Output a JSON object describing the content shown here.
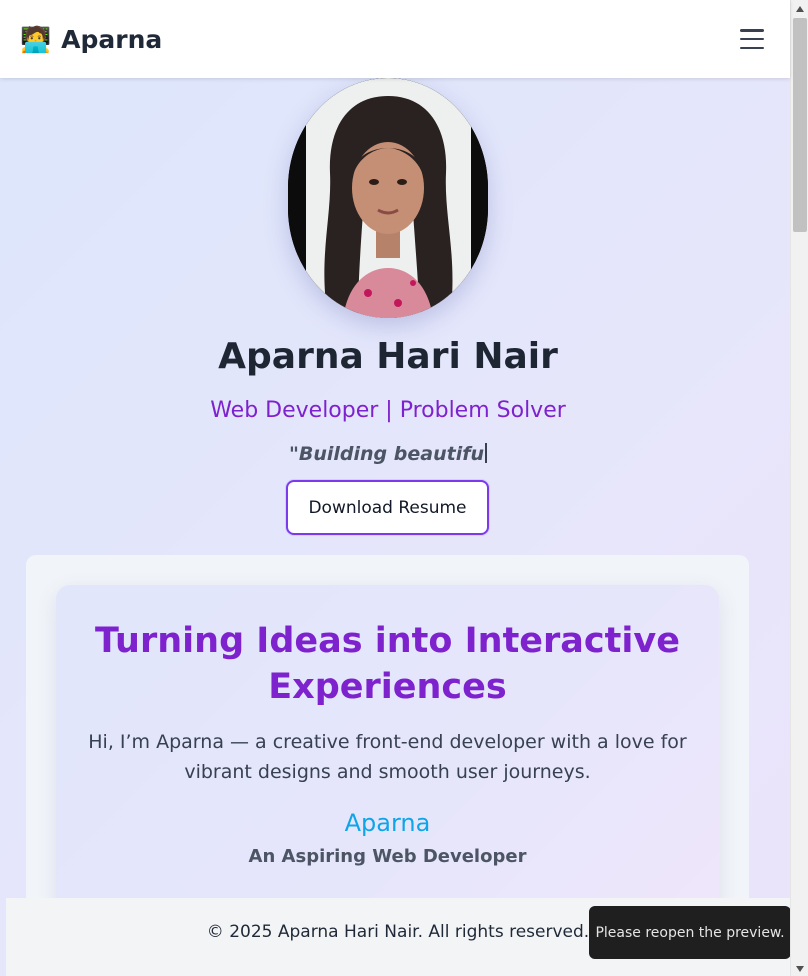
{
  "nav": {
    "brand_icon": "🧑‍💻",
    "brand_name": "Aparna",
    "menu_icon": "hamburger-menu-icon"
  },
  "hero": {
    "name": "Aparna Hari Nair",
    "role": "Web Developer | Problem Solver",
    "quote": "\"Building beautifu",
    "resume_button": "Download Resume"
  },
  "about": {
    "title": "Turning Ideas into Interactive Experiences",
    "text": "Hi, I’m Aparna — a creative front-end developer with a love for vibrant designs and smooth user journeys.",
    "name": "Aparna",
    "subtitle": "An Aspiring Web Developer"
  },
  "footer": {
    "text": "© 2025 Aparna Hari Nair. All rights reserved."
  },
  "toast": {
    "text": "Please reopen the preview."
  },
  "colors": {
    "accent": "#7e22ce",
    "link": "#0ea5e9",
    "button_border": "#7c3aed"
  }
}
